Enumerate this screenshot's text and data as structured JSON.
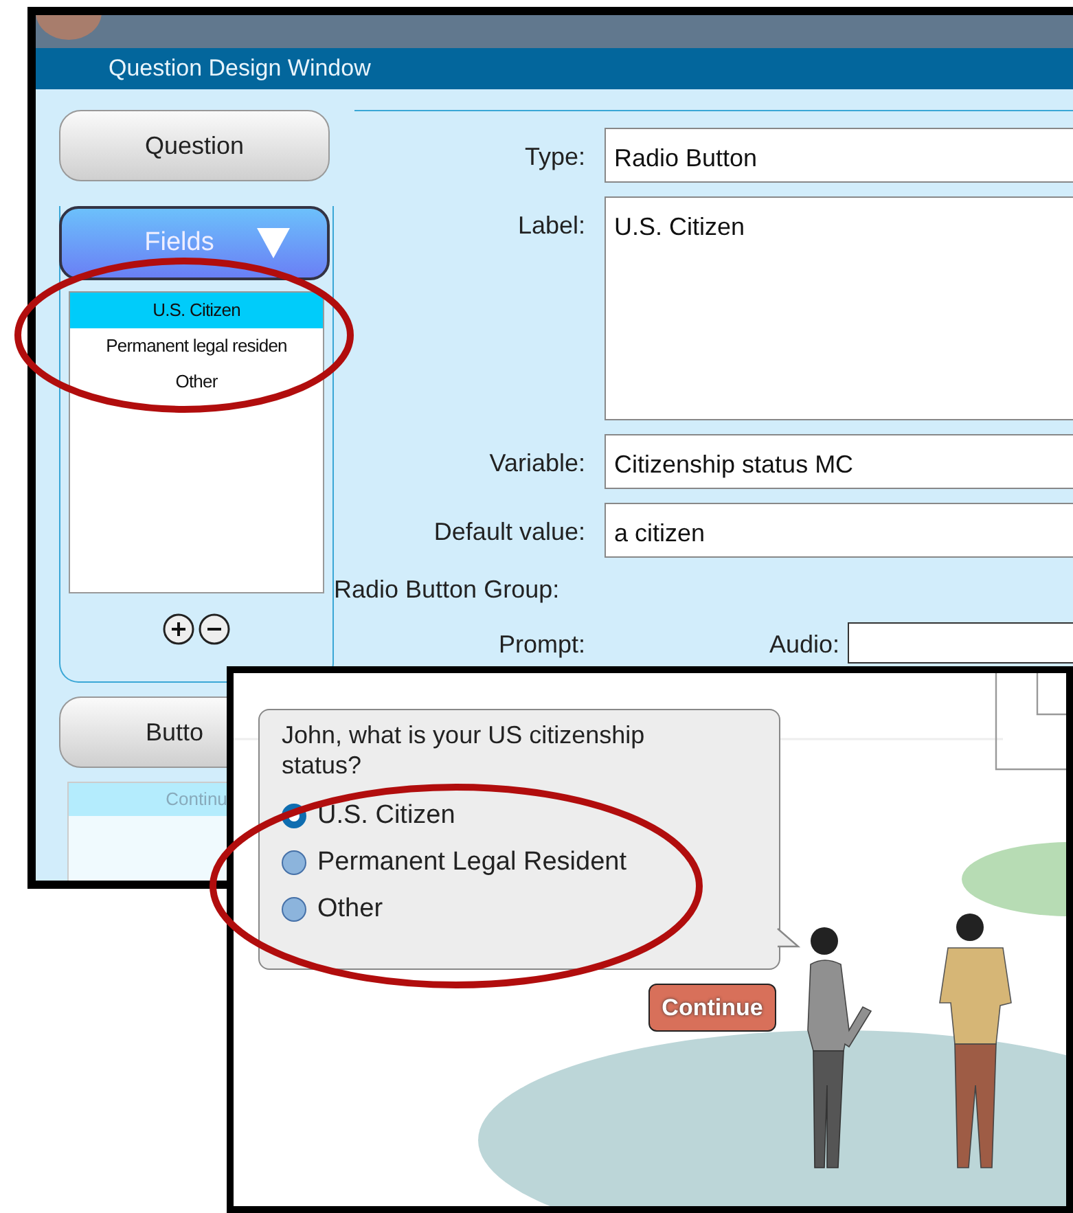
{
  "design_window": {
    "title": "Question Design Window",
    "question_button": "Question",
    "fields_button": "Fields",
    "fields_list": [
      {
        "label": "U.S. Citizen",
        "selected": true
      },
      {
        "label": "Permanent legal residen",
        "selected": false
      },
      {
        "label": "Other",
        "selected": false
      }
    ],
    "buttons_tab": "Butto",
    "buttons_list": [
      {
        "label": "Continu",
        "selected": true
      }
    ],
    "form": [
      {
        "kind": "input",
        "label": "Type:",
        "value": "Radio Button"
      },
      {
        "kind": "textarea",
        "label": "Label:",
        "value": "U.S. Citizen"
      },
      {
        "kind": "input",
        "label": "Variable:",
        "value": "Citizenship status MC"
      },
      {
        "kind": "input",
        "label": "Default value:",
        "value": "a citizen"
      },
      {
        "kind": "heading",
        "label": "Radio Button Group:"
      },
      {
        "kind": "prompt",
        "label": "Prompt:",
        "extra_label": "Audio:"
      }
    ]
  },
  "preview_window": {
    "question": "John, what is your US citizenship status?",
    "options": [
      {
        "label": "U.S. Citizen",
        "selected": true
      },
      {
        "label": "Permanent Legal Resident",
        "selected": false
      },
      {
        "label": "Other",
        "selected": false
      }
    ],
    "continue_button": "Continue"
  }
}
